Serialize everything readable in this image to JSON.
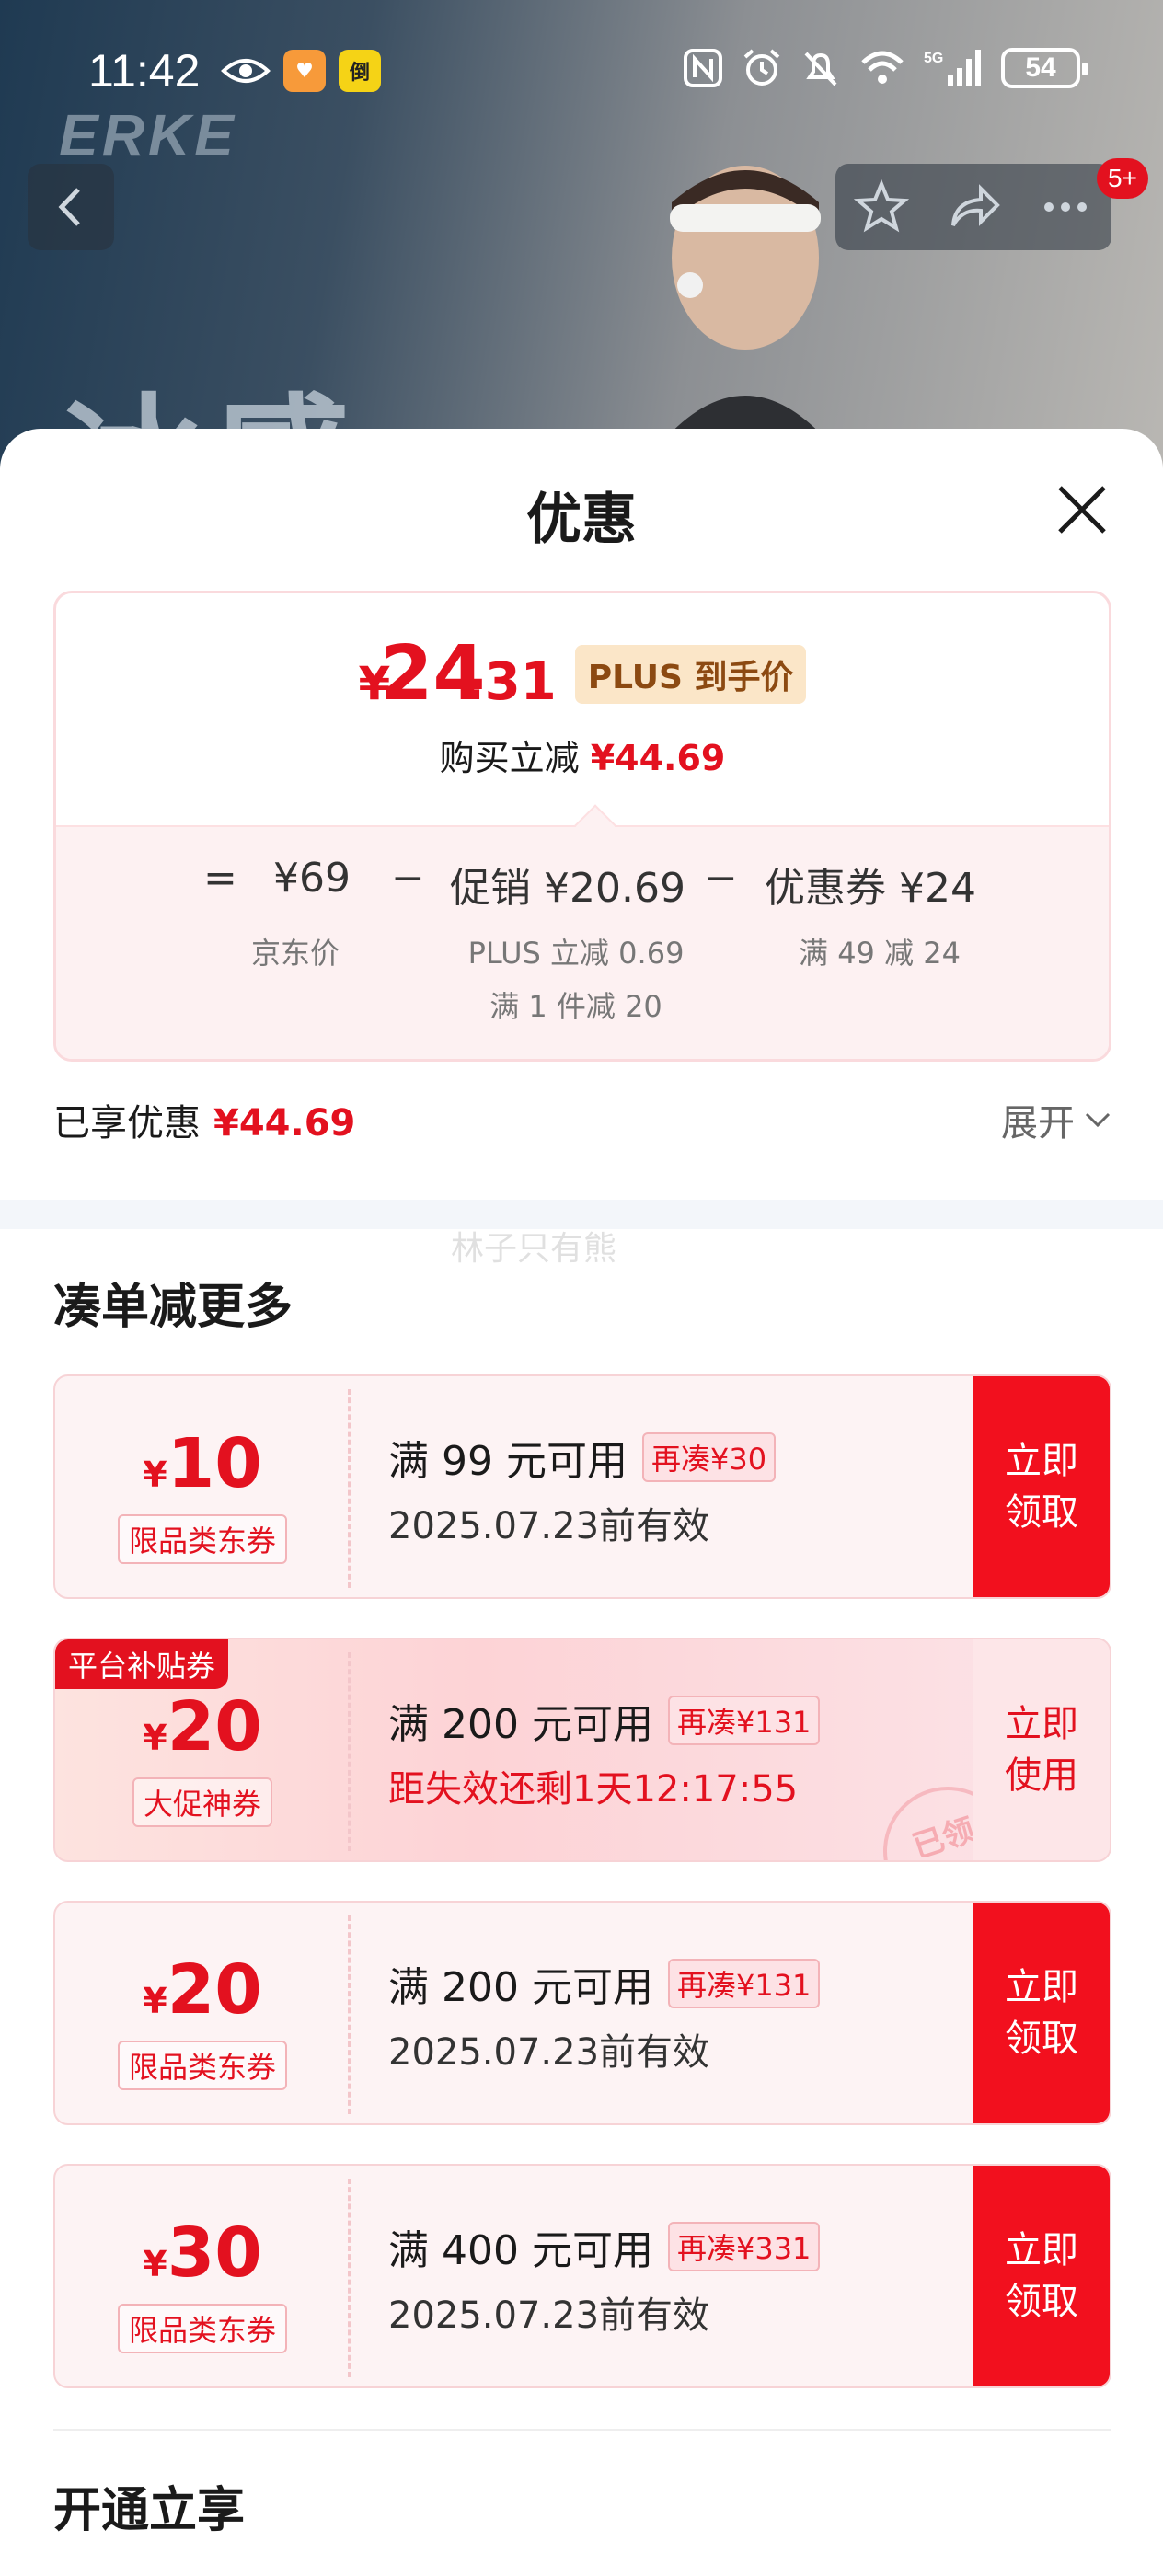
{
  "status_bar": {
    "time": "11:42",
    "app_badge_2": "倒",
    "network": "5G",
    "battery": "54"
  },
  "product": {
    "brand": "ERKE",
    "headline_fragment": "冰感",
    "notification_count": "5+"
  },
  "sheet": {
    "title": "优惠",
    "price": {
      "currency": "¥",
      "integer": "24",
      "decimal": ".31",
      "tag": "PLUS 到手价",
      "reduction_label": "购买立减",
      "reduction_value": "¥44.69"
    },
    "formula": {
      "equals": "=",
      "jd_price": "¥69",
      "jd_price_note": "京东价",
      "minus1": "−",
      "promo": "促销 ¥20.69",
      "promo_note1": "PLUS 立减 0.69",
      "promo_note2": "满 1 件减 20",
      "minus2": "−",
      "coupon": "优惠券 ¥24",
      "coupon_note": "满 49 减 24"
    },
    "enjoyed": {
      "label": "已享优惠",
      "value": "¥44.69",
      "expand": "展开"
    },
    "watermark": "林子只有熊",
    "section_more": "凑单减更多",
    "section_open": "开通立享",
    "coupons": [
      {
        "currency": "¥",
        "amount": "10",
        "type": "限品类东券",
        "condition": "满 99 元可用",
        "more": "再凑¥30",
        "validity": "2025.07.23前有效",
        "button": [
          "立即",
          "领取"
        ]
      },
      {
        "platform_tag": "平台补贴券",
        "currency": "¥",
        "amount": "20",
        "type": "大促神券",
        "condition": "满 200 元可用",
        "more": "再凑¥131",
        "validity": "距失效还剩1天12:17:55",
        "button": [
          "立即",
          "使用"
        ],
        "stamp": "已领"
      },
      {
        "currency": "¥",
        "amount": "20",
        "type": "限品类东券",
        "condition": "满 200 元可用",
        "more": "再凑¥131",
        "validity": "2025.07.23前有效",
        "button": [
          "立即",
          "领取"
        ]
      },
      {
        "currency": "¥",
        "amount": "30",
        "type": "限品类东券",
        "condition": "满 400 元可用",
        "more": "再凑¥331",
        "validity": "2025.07.23前有效",
        "button": [
          "立即",
          "领取"
        ]
      }
    ]
  },
  "colors": {
    "accent_red": "#e3111f",
    "plus_gold": "#fbe6c8"
  }
}
